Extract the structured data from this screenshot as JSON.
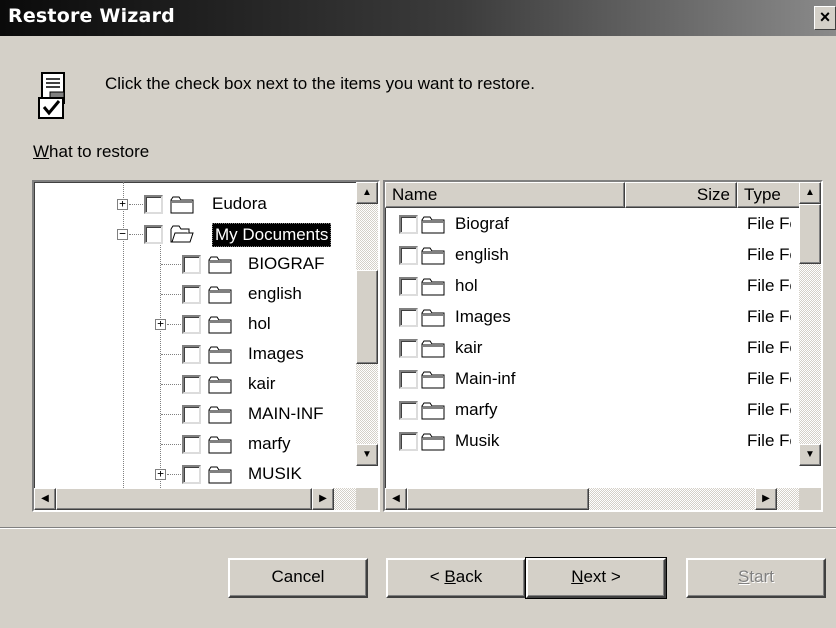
{
  "window": {
    "title": "Restore Wizard",
    "close_label": "×"
  },
  "header": {
    "instruction": "Click the check box next to the items you want to restore."
  },
  "what_to_restore": {
    "accel": "W",
    "label_rest": "hat to restore"
  },
  "tree": {
    "items": [
      {
        "label": "Eudora",
        "expander": "+"
      },
      {
        "label": "My Documents",
        "expander": "−"
      },
      {
        "label": "BIOGRAF"
      },
      {
        "label": "english"
      },
      {
        "label": "hol",
        "expander": "+"
      },
      {
        "label": "Images"
      },
      {
        "label": "kair"
      },
      {
        "label": "MAIN-INF"
      },
      {
        "label": "marfy"
      },
      {
        "label": "MUSIK",
        "expander": "+"
      }
    ]
  },
  "list": {
    "columns": [
      "Name",
      "Size",
      "Type"
    ],
    "rows": [
      {
        "name": "Biograf",
        "type": "File Folder"
      },
      {
        "name": "english",
        "type": "File Folder"
      },
      {
        "name": "hol",
        "type": "File Folder"
      },
      {
        "name": "Images",
        "type": "File Folder"
      },
      {
        "name": "kair",
        "type": "File Folder"
      },
      {
        "name": "Main-inf",
        "type": "File Folder"
      },
      {
        "name": "marfy",
        "type": "File Folder"
      },
      {
        "name": "Musik",
        "type": "File Folder"
      }
    ]
  },
  "buttons": {
    "cancel": "Cancel",
    "back_prefix": "< ",
    "back_accel": "B",
    "back_rest": "ack",
    "next_accel": "N",
    "next_rest": "ext >",
    "start_accel": "S",
    "start_rest": "tart"
  }
}
